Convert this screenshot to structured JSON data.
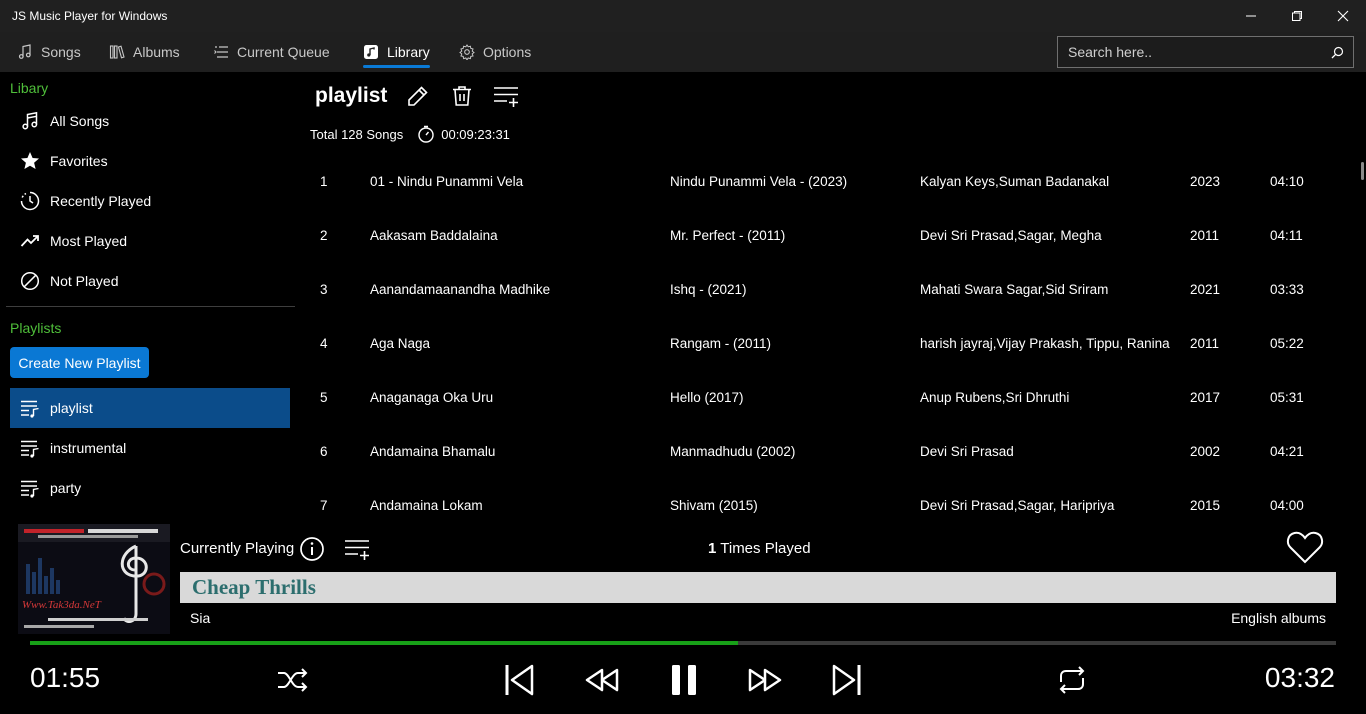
{
  "window": {
    "title": "JS Music Player for Windows"
  },
  "nav": {
    "tabs": [
      {
        "label": "Songs",
        "icon": "music-note-icon"
      },
      {
        "label": "Albums",
        "icon": "albums-icon"
      },
      {
        "label": "Current Queue",
        "icon": "queue-icon"
      },
      {
        "label": "Library",
        "icon": "library-icon",
        "active": true
      },
      {
        "label": "Options",
        "icon": "gear-icon"
      }
    ],
    "search_placeholder": "Search here.."
  },
  "sidebar": {
    "library_title": "Libary",
    "library_items": [
      {
        "label": "All Songs",
        "icon": "music-note-icon"
      },
      {
        "label": "Favorites",
        "icon": "star-icon"
      },
      {
        "label": "Recently Played",
        "icon": "history-clock-icon"
      },
      {
        "label": "Most Played",
        "icon": "trending-up-icon"
      },
      {
        "label": "Not Played",
        "icon": "block-icon"
      }
    ],
    "playlists_title": "Playlists",
    "create_button": "Create New Playlist",
    "playlists": [
      {
        "label": "playlist",
        "selected": true
      },
      {
        "label": "instrumental"
      },
      {
        "label": "party"
      }
    ]
  },
  "main": {
    "playlist_title": "playlist",
    "total_songs": "Total 128 Songs",
    "total_duration": "00:09:23:31",
    "songs": [
      {
        "num": "1",
        "title": "01 - Nindu Punammi Vela",
        "album": "Nindu Punammi Vela - (2023)",
        "artist": "Kalyan Keys,Suman Badanakal",
        "year": "2023",
        "duration": "04:10"
      },
      {
        "num": "2",
        "title": "Aakasam Baddalaina",
        "album": "Mr. Perfect - (2011)",
        "artist": "Devi Sri Prasad,Sagar, Megha",
        "year": "2011",
        "duration": "04:11"
      },
      {
        "num": "3",
        "title": "Aanandamaanandha Madhike",
        "album": "Ishq - (2021)",
        "artist": "Mahati Swara Sagar,Sid Sriram",
        "year": "2021",
        "duration": "03:33"
      },
      {
        "num": "4",
        "title": "Aga Naga",
        "album": "Rangam - (2011)",
        "artist": "harish jayraj,Vijay Prakash, Tippu, Ranina",
        "year": "2011",
        "duration": "05:22"
      },
      {
        "num": "5",
        "title": "Anaganaga Oka Uru",
        "album": "Hello (2017)",
        "artist": "Anup Rubens,Sri Dhruthi",
        "year": "2017",
        "duration": "05:31"
      },
      {
        "num": "6",
        "title": "Andamaina Bhamalu",
        "album": "Manmadhudu (2002)",
        "artist": "Devi Sri Prasad",
        "year": "2002",
        "duration": "04:21"
      },
      {
        "num": "7",
        "title": "Andamaina Lokam",
        "album": "Shivam (2015)",
        "artist": "Devi Sri Prasad,Sagar, Haripriya",
        "year": "2015",
        "duration": "04:00"
      }
    ]
  },
  "player": {
    "currently_playing_label": "Currently Playing",
    "times_played_count": "1",
    "times_played_label": "Times Played",
    "song_title": "Cheap Thrills",
    "artist": "Sia",
    "album": "English albums",
    "current_time": "01:55",
    "total_time": "03:32",
    "progress": 0.542,
    "album_art_text": "Www.Tak3da.NeT",
    "colors": {
      "accent": "#0a78d4",
      "progress": "#18a018",
      "section": "#4fbf3a",
      "selected": "#0b4c8a"
    }
  }
}
